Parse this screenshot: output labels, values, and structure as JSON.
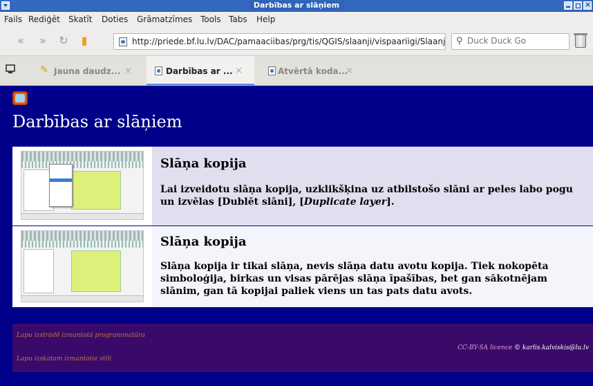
{
  "window": {
    "title": "Darbības ar slāņiem"
  },
  "menubar": {
    "items": [
      "Fails",
      "Rediģēt",
      "Skatīt",
      "Doties",
      "Grāmatzīmes",
      "Tools",
      "Tabs",
      "Help"
    ]
  },
  "navbar": {
    "url": "http://priede.bf.lu.lv/DAC/pamaaciibas/prg/tis/QGIS/slaanji/vispaariigi/Slaanju-",
    "search_placeholder": "Duck Duck Go"
  },
  "tabs": [
    {
      "label": "Jauna daudz...",
      "close": "×",
      "active": false
    },
    {
      "label": "Darbības ar ...",
      "close": "×",
      "active": true
    },
    {
      "label": "Atvērtā koda...",
      "close": "×",
      "active": false
    }
  ],
  "page": {
    "title": "Darbības ar slāņiem",
    "rows": [
      {
        "heading": "Slāņa kopija",
        "text_before": "Lai izveidotu slāņa kopija, uzklikšķina uz atbilstošo slāni ar peles labo pogu un izvēlas [Dublēt slāni], [",
        "text_italic": "Duplicate layer",
        "text_after": "]."
      },
      {
        "heading": "Slāņa kopija",
        "text": "Slāņa kopija ir tikai slāņa, nevis slāņa datu avotu kopija. Tiek nokopēta simboloģija, birkas un visas pārējas slāņa īpašības, bet gan sākotnējam slānim, gan tā kopijai paliek viens un tas pats datu avots."
      }
    ],
    "footer": {
      "link1": "Lapu izstrādē izmantotā programmatūra",
      "link2": "Lapu izskatam izmantotie stili",
      "license": "CC-BY-SA licence",
      "author": " © karlis.kalviskis@lu.lv"
    }
  },
  "colors": {
    "page_bg": "#00008a",
    "footer_bg": "#3a0a6b",
    "row1_bg": "#dfdff0",
    "row2_bg": "#f4f4fb",
    "titlebar": "#2f62b8"
  }
}
